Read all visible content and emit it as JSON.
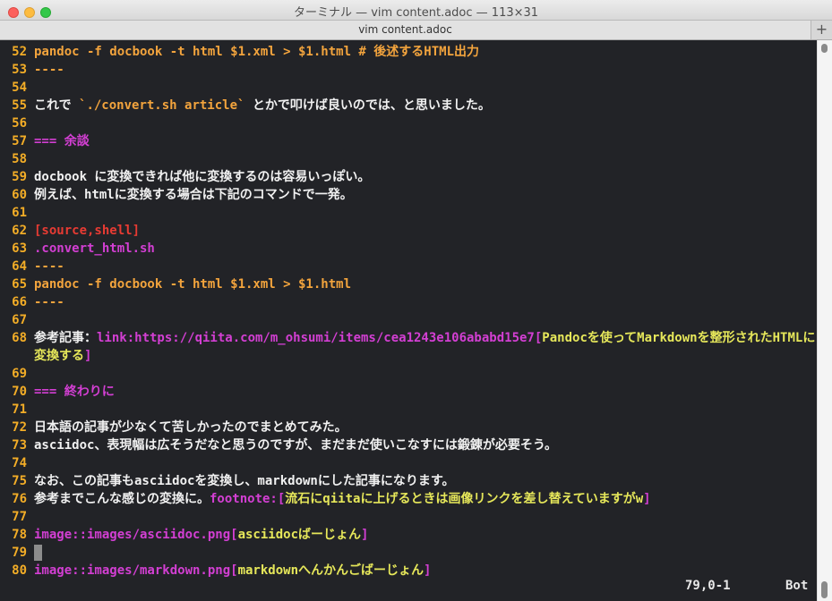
{
  "window": {
    "title": "ターミナル — vim content.adoc — 113×31",
    "tab_label": "vim content.adoc",
    "new_tab": "+"
  },
  "lines": [
    {
      "n": "52",
      "segs": [
        {
          "t": "pandoc -f docbook -t html $1.xml > $1.html # 後述するHTML出力",
          "c": "orange"
        }
      ]
    },
    {
      "n": "53",
      "segs": [
        {
          "t": "----",
          "c": "orange"
        }
      ]
    },
    {
      "n": "54",
      "segs": []
    },
    {
      "n": "55",
      "segs": [
        {
          "t": "これで ",
          "c": "white"
        },
        {
          "t": "`./convert.sh article`",
          "c": "orange"
        },
        {
          "t": " とかで叩けば良いのでは、と思いました。",
          "c": "white"
        }
      ]
    },
    {
      "n": "56",
      "segs": []
    },
    {
      "n": "57",
      "segs": [
        {
          "t": "=== 余談",
          "c": "magenta"
        }
      ]
    },
    {
      "n": "58",
      "segs": []
    },
    {
      "n": "59",
      "segs": [
        {
          "t": "docbook に変換できれば他に変換するのは容易いっぽい。",
          "c": "white"
        }
      ]
    },
    {
      "n": "60",
      "segs": [
        {
          "t": "例えば、htmlに変換する場合は下記のコマンドで一発。",
          "c": "white"
        }
      ]
    },
    {
      "n": "61",
      "segs": []
    },
    {
      "n": "62",
      "segs": [
        {
          "t": "[source,shell]",
          "c": "red"
        }
      ]
    },
    {
      "n": "63",
      "segs": [
        {
          "t": ".convert_html.sh",
          "c": "magenta"
        }
      ]
    },
    {
      "n": "64",
      "segs": [
        {
          "t": "----",
          "c": "orange"
        }
      ]
    },
    {
      "n": "65",
      "segs": [
        {
          "t": "pandoc -f docbook -t html $1.xml > $1.html",
          "c": "orange"
        }
      ]
    },
    {
      "n": "66",
      "segs": [
        {
          "t": "----",
          "c": "orange"
        }
      ]
    },
    {
      "n": "67",
      "segs": []
    },
    {
      "n": "68",
      "segs": [
        {
          "t": "参考記事：",
          "c": "white"
        },
        {
          "t": "link:https://qiita.com/m_ohsumi/items/cea1243e106ababd15e7[",
          "c": "magenta"
        },
        {
          "t": "Pandocを使ってMarkdownを整形されたHTMLに",
          "c": "yellow"
        }
      ]
    },
    {
      "n": "",
      "segs": [
        {
          "t": "変換する",
          "c": "yellow"
        },
        {
          "t": "]",
          "c": "magenta"
        }
      ]
    },
    {
      "n": "69",
      "segs": []
    },
    {
      "n": "70",
      "segs": [
        {
          "t": "=== 終わりに",
          "c": "magenta"
        }
      ]
    },
    {
      "n": "71",
      "segs": []
    },
    {
      "n": "72",
      "segs": [
        {
          "t": "日本語の記事が少なくて苦しかったのでまとめてみた。",
          "c": "white"
        }
      ]
    },
    {
      "n": "73",
      "segs": [
        {
          "t": "asciidoc、表現幅は広そうだなと思うのですが、まだまだ使いこなすには鍛錬が必要そう。",
          "c": "white"
        }
      ]
    },
    {
      "n": "74",
      "segs": []
    },
    {
      "n": "75",
      "segs": [
        {
          "t": "なお、この記事もasciidocを変換し、markdownにした記事になります。",
          "c": "white"
        }
      ]
    },
    {
      "n": "76",
      "segs": [
        {
          "t": "参考までこんな感じの変換に。",
          "c": "white"
        },
        {
          "t": "footnote:[",
          "c": "magenta"
        },
        {
          "t": "流石にqiitaに上げるときは画像リンクを差し替えていますがw",
          "c": "yellow"
        },
        {
          "t": "]",
          "c": "magenta"
        }
      ]
    },
    {
      "n": "77",
      "segs": []
    },
    {
      "n": "78",
      "segs": [
        {
          "t": "image::images/asciidoc.png[",
          "c": "magenta"
        },
        {
          "t": "asciidocばーじょん",
          "c": "yellow"
        },
        {
          "t": "]",
          "c": "magenta"
        }
      ]
    },
    {
      "n": "79",
      "segs": [],
      "cursor": true
    },
    {
      "n": "80",
      "segs": [
        {
          "t": "image::images/markdown.png[",
          "c": "magenta"
        },
        {
          "t": "markdownへんかんごばーじょん",
          "c": "yellow"
        },
        {
          "t": "]",
          "c": "magenta"
        }
      ]
    }
  ],
  "status": {
    "position": "79,0-1",
    "scroll": "Bot"
  }
}
